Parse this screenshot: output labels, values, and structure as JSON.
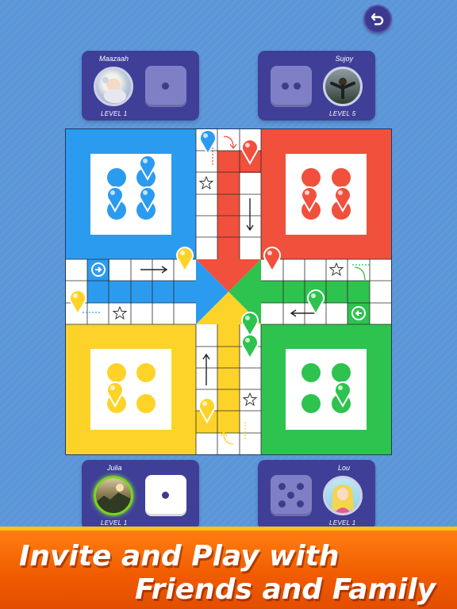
{
  "players": {
    "top_left": {
      "name": "Maazaah",
      "level": "LEVEL 1"
    },
    "top_right": {
      "name": "Sujoy",
      "level": "LEVEL 5"
    },
    "bottom_left": {
      "name": "Julia",
      "level": "LEVEL 1"
    },
    "bottom_right": {
      "name": "Lou",
      "level": "LEVEL 1"
    }
  },
  "dice": {
    "top_left": 1,
    "top_right": 2,
    "bottom_left": 1,
    "bottom_right": 5
  },
  "banner": {
    "line1": "Invite and Play with",
    "line2": "Friends and Family"
  },
  "colors": {
    "blue": "#2b9bf0",
    "red": "#f0503c",
    "yellow": "#fdd32a",
    "green": "#2ec24f",
    "panel": "#3f3f98",
    "background": "#5b96d8",
    "banner": "#f26a05"
  },
  "icons": [
    "back-arrow-icon",
    "star-icon",
    "arrow-icon",
    "start-arrow-icon",
    "pawn-icon",
    "dice-icon",
    "avatar-icon"
  ]
}
